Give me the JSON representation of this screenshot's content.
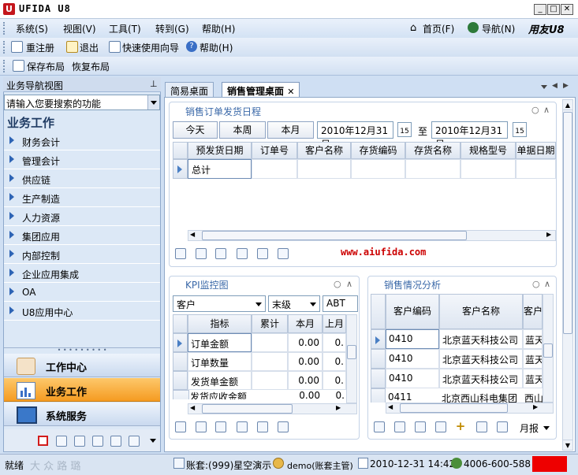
{
  "window": {
    "title": "UFIDA U8",
    "logo_letter": "U"
  },
  "menu": {
    "items": [
      "系统(S)",
      "视图(V)",
      "工具(T)",
      "转到(G)",
      "帮助(H)"
    ],
    "right": {
      "home": "首页(F)",
      "nav": "导航(N)",
      "brand": "用友U8"
    }
  },
  "toolbar1": {
    "relogin": "重注册",
    "exit": "退出",
    "wizard": "快速使用向导",
    "help": "帮助(H)"
  },
  "toolbar2": {
    "save_layout": "保存布局",
    "restore_layout": "恢复布局"
  },
  "nav": {
    "header": "业务导航视图",
    "search_placeholder": "请输入您要搜索的功能",
    "section_title": "业务工作",
    "items": [
      "财务会计",
      "管理会计",
      "供应链",
      "生产制造",
      "人力资源",
      "集团应用",
      "内部控制",
      "企业应用集成",
      "OA",
      "U8应用中心"
    ],
    "bottom": [
      "工作中心",
      "业务工作",
      "系统服务"
    ]
  },
  "tabs": [
    "简易桌面",
    "销售管理桌面"
  ],
  "sched": {
    "title": "销售订单发货日程",
    "buttons": [
      "今天",
      "本周",
      "本月"
    ],
    "date_from": "2010年12月31日",
    "to": "至",
    "date_to": "2010年12月31日",
    "calendar_day": "15",
    "columns": [
      "预发货日期",
      "订单号",
      "客户名称",
      "存货编码",
      "存货名称",
      "规格型号",
      "单据日期"
    ],
    "total_label": "总计"
  },
  "watermark": "www.aiufida.com",
  "kpi": {
    "title": "KPI监控图",
    "combo1": "客户",
    "combo2": "末级",
    "combo3": "ABT",
    "columns": [
      "指标",
      "累计",
      "本月",
      "上月"
    ],
    "rows": [
      {
        "name": "订单金额",
        "cum": "",
        "month": "0.00",
        "last": "0."
      },
      {
        "name": "订单数量",
        "cum": "",
        "month": "0.00",
        "last": "0."
      },
      {
        "name": "发货单金额",
        "cum": "",
        "month": "0.00",
        "last": "0."
      },
      {
        "name": "发货应收金额",
        "cum": "",
        "month": "0.00",
        "last": "0."
      }
    ]
  },
  "sales": {
    "title": "销售情况分析",
    "columns": [
      "客户编码",
      "客户名称",
      "客户"
    ],
    "rows": [
      {
        "code": "0410",
        "name": "北京蓝天科技公司",
        "abbr": "蓝天"
      },
      {
        "code": "0410",
        "name": "北京蓝天科技公司",
        "abbr": "蓝天"
      },
      {
        "code": "0410",
        "name": "北京蓝天科技公司",
        "abbr": "蓝天"
      },
      {
        "code": "0411",
        "name": "北京西山科电集团",
        "abbr": "西山"
      }
    ],
    "period": "月报"
  },
  "status": {
    "ready": "就绪",
    "watermark": "大 众 路 璐",
    "account": "账套:(999)星空演示",
    "user": "demo(账套主管)",
    "datetime": "2010-12-31  14:42",
    "phone": "4006-600-588"
  },
  "colors": {
    "accent": "#2e64b5",
    "active_nav": "#f9a53a",
    "alert": "#ee0000",
    "watermark": "#cc0000"
  }
}
